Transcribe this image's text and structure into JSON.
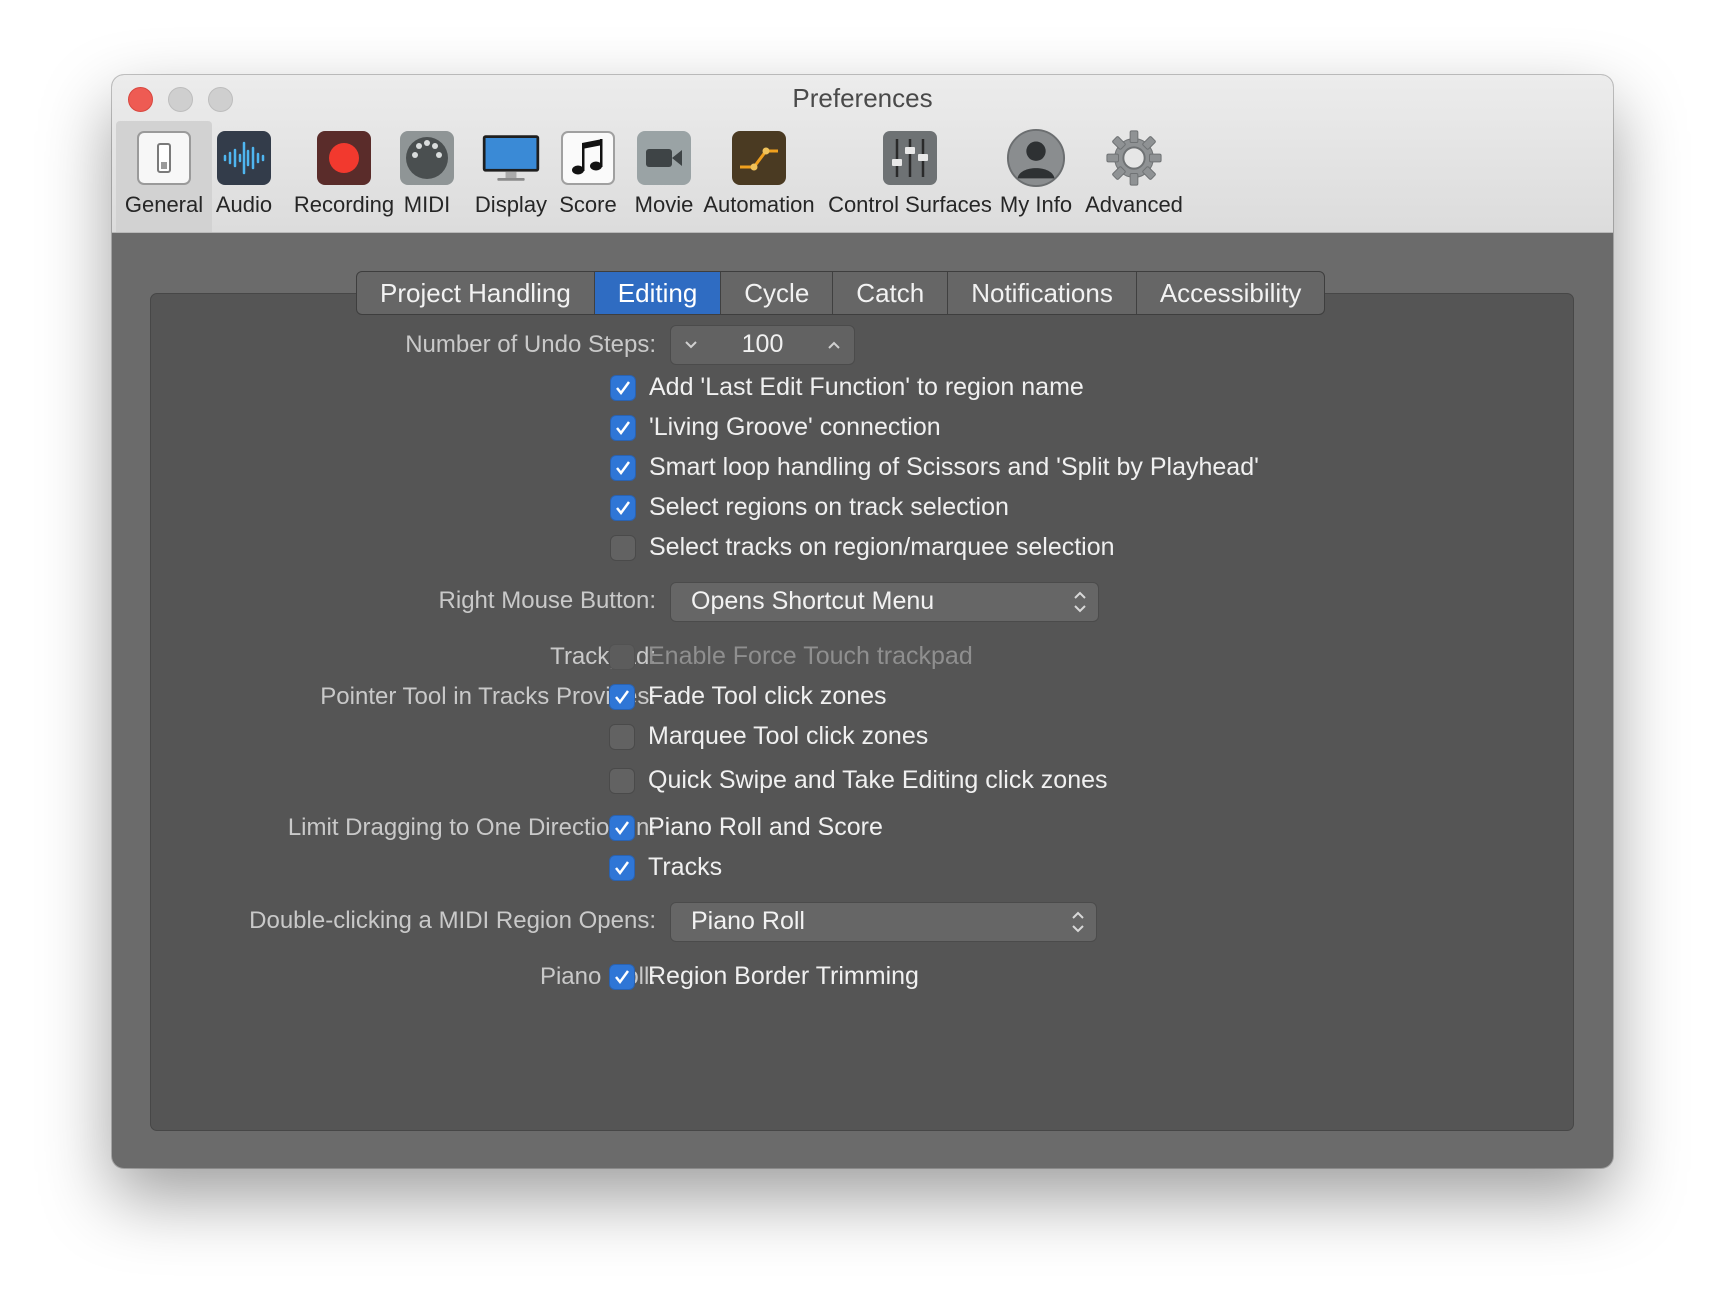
{
  "window": {
    "title": "Preferences"
  },
  "toolbar": [
    {
      "label": "General",
      "icon": "general-icon",
      "selected": true
    },
    {
      "label": "Audio",
      "icon": "audio-waveform-icon"
    },
    {
      "label": "Recording",
      "icon": "record-icon"
    },
    {
      "label": "MIDI",
      "icon": "midi-connector-icon"
    },
    {
      "label": "Display",
      "icon": "display-monitor-icon"
    },
    {
      "label": "Score",
      "icon": "music-note-icon"
    },
    {
      "label": "Movie",
      "icon": "video-camera-icon"
    },
    {
      "label": "Automation",
      "icon": "automation-curve-icon"
    },
    {
      "label": "Control Surfaces",
      "icon": "faders-icon"
    },
    {
      "label": "My Info",
      "icon": "user-silhouette-icon"
    },
    {
      "label": "Advanced",
      "icon": "gear-icon"
    }
  ],
  "tabs": [
    {
      "label": "Project Handling"
    },
    {
      "label": "Editing",
      "active": true
    },
    {
      "label": "Cycle"
    },
    {
      "label": "Catch"
    },
    {
      "label": "Notifications"
    },
    {
      "label": "Accessibility"
    }
  ],
  "undo": {
    "label": "Number of Undo Steps:",
    "value": "100"
  },
  "options": [
    {
      "text": "Add 'Last Edit Function' to region name",
      "checked": true
    },
    {
      "text": "'Living Groove' connection",
      "checked": true
    },
    {
      "text": "Smart loop handling of Scissors and 'Split by Playhead'",
      "checked": true
    },
    {
      "text": "Select regions on track selection",
      "checked": true
    },
    {
      "text": "Select tracks on region/marquee selection",
      "checked": false
    }
  ],
  "right_mouse": {
    "label": "Right Mouse Button:",
    "value": "Opens Shortcut Menu"
  },
  "trackpad": {
    "label": "Trackpad:",
    "option": "Enable Force Touch trackpad",
    "checked": false,
    "enabled": false
  },
  "pointer_tool": {
    "label": "Pointer Tool in Tracks Provides:",
    "options": [
      {
        "text": "Fade Tool click zones",
        "checked": true
      },
      {
        "text": "Marquee Tool click zones",
        "checked": false
      },
      {
        "text": "Quick Swipe and Take Editing click zones",
        "checked": false
      }
    ]
  },
  "limit_dragging": {
    "label": "Limit Dragging to One Direction In:",
    "options": [
      {
        "text": "Piano Roll and Score",
        "checked": true
      },
      {
        "text": "Tracks",
        "checked": true
      }
    ]
  },
  "double_click": {
    "label": "Double-clicking a MIDI Region Opens:",
    "value": "Piano Roll"
  },
  "piano_roll": {
    "label": "Piano Roll:",
    "option": "Region Border Trimming",
    "checked": true
  },
  "colors": {
    "accent": "#2f76d6",
    "panel": "#555555",
    "window_bg": "#6b6b6b"
  }
}
